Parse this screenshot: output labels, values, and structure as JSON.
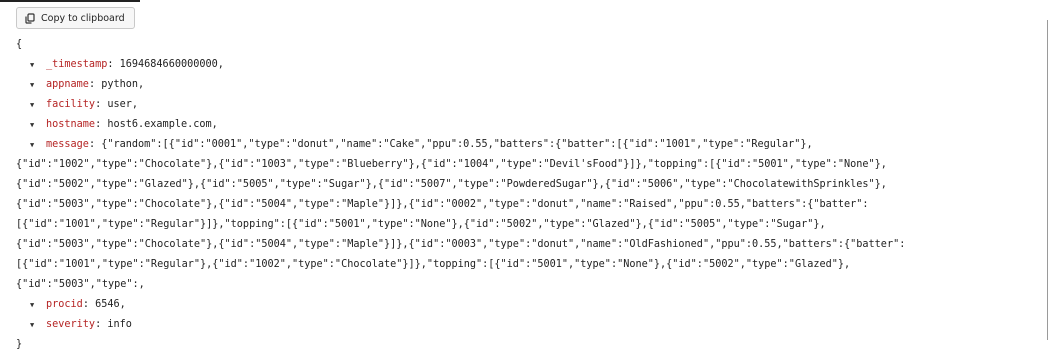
{
  "toolbar": {
    "copy_label": "Copy to clipboard",
    "copy_icon": "copy-icon"
  },
  "json": {
    "open_brace": "{",
    "close_brace": "}",
    "fields": [
      {
        "key": "_timestamp",
        "value": "1694684660000000,"
      },
      {
        "key": "appname",
        "value": "python,"
      },
      {
        "key": "facility",
        "value": "user,"
      },
      {
        "key": "hostname",
        "value": "host6.example.com,"
      }
    ],
    "message": {
      "key": "message",
      "lines": [
        "{\"random\":[{\"id\":\"0001\",\"type\":\"donut\",\"name\":\"Cake\",\"ppu\":0.55,\"batters\":{\"batter\":[{\"id\":\"1001\",\"type\":\"Regular\"},",
        "{\"id\":\"1002\",\"type\":\"Chocolate\"},{\"id\":\"1003\",\"type\":\"Blueberry\"},{\"id\":\"1004\",\"type\":\"Devil'sFood\"}]},\"topping\":[{\"id\":\"5001\",\"type\":\"None\"},",
        "{\"id\":\"5002\",\"type\":\"Glazed\"},{\"id\":\"5005\",\"type\":\"Sugar\"},{\"id\":\"5007\",\"type\":\"PowderedSugar\"},{\"id\":\"5006\",\"type\":\"ChocolatewithSprinkles\"},",
        "{\"id\":\"5003\",\"type\":\"Chocolate\"},{\"id\":\"5004\",\"type\":\"Maple\"}]},{\"id\":\"0002\",\"type\":\"donut\",\"name\":\"Raised\",\"ppu\":0.55,\"batters\":{\"batter\":",
        "[{\"id\":\"1001\",\"type\":\"Regular\"}]},\"topping\":[{\"id\":\"5001\",\"type\":\"None\"},{\"id\":\"5002\",\"type\":\"Glazed\"},{\"id\":\"5005\",\"type\":\"Sugar\"},",
        "{\"id\":\"5003\",\"type\":\"Chocolate\"},{\"id\":\"5004\",\"type\":\"Maple\"}]},{\"id\":\"0003\",\"type\":\"donut\",\"name\":\"OldFashioned\",\"ppu\":0.55,\"batters\":{\"batter\":",
        "[{\"id\":\"1001\",\"type\":\"Regular\"},{\"id\":\"1002\",\"type\":\"Chocolate\"}]},\"topping\":[{\"id\":\"5001\",\"type\":\"None\"},{\"id\":\"5002\",\"type\":\"Glazed\"},",
        "{\"id\":\"5003\",\"type\":,"
      ]
    },
    "trailing_fields": [
      {
        "key": "procid",
        "value": "6546,"
      },
      {
        "key": "severity",
        "value": "info"
      }
    ]
  },
  "colors": {
    "key": "#b52424",
    "value": "#222222"
  }
}
